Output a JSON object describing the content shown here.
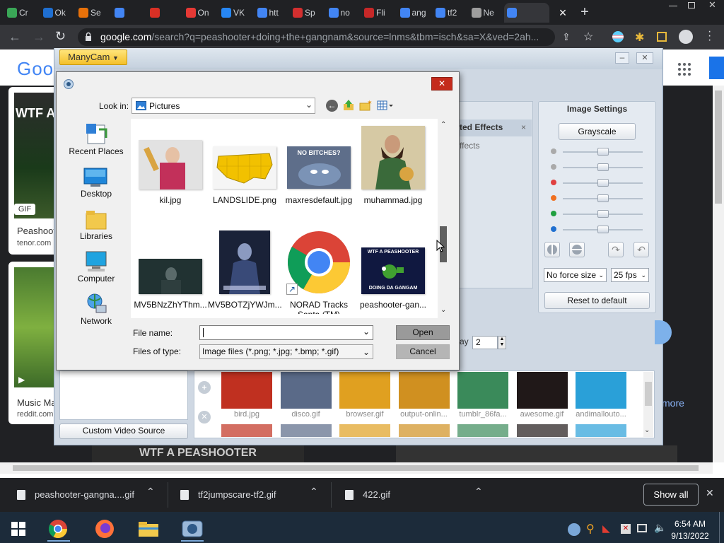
{
  "browser": {
    "tabs": [
      {
        "label": "Cr",
        "color": "#3aa757"
      },
      {
        "label": "Ok",
        "color": "#1f6fd1"
      },
      {
        "label": "Se",
        "color": "#e8710a"
      },
      {
        "label": "",
        "color": "#4285f4"
      },
      {
        "label": "",
        "color": "#d93025"
      },
      {
        "label": "On",
        "color": "#e53935"
      },
      {
        "label": "VK",
        "color": "#2787f5"
      },
      {
        "label": "htt",
        "color": "#4285f4"
      },
      {
        "label": "Sp",
        "color": "#d32f2f"
      },
      {
        "label": "no",
        "color": "#4285f4"
      },
      {
        "label": "Fli",
        "color": "#c62828"
      },
      {
        "label": "ang",
        "color": "#4285f4"
      },
      {
        "label": "tf2",
        "color": "#4285f4"
      },
      {
        "label": "Ne",
        "color": "#9e9e9e"
      },
      {
        "label": "",
        "color": "#4285f4",
        "active": true
      }
    ],
    "url_domain": "google.com",
    "url_rest": "/search?q=peashooter+doing+the+gangnam&source=lnms&tbm=isch&sa=X&ved=2ah...",
    "tab_close": "×",
    "new_tab": "+"
  },
  "google": {
    "logo": "Goo",
    "results": [
      {
        "badge": "GIF",
        "title": "Peashoot",
        "site": "tenor.com",
        "thumb_text": "WTF A"
      },
      {
        "title": "Music Ma",
        "site": "reddit.com"
      }
    ],
    "more_label": "more",
    "bottom_banner": "WTF A PEASHOOTER"
  },
  "manycam": {
    "title_button": "ManyCam",
    "effects_header": "ted Effects",
    "effects_sub": "ffects",
    "image_settings": {
      "header": "Image Settings",
      "grayscale_button": "Grayscale",
      "slider_levels": [
        0.5,
        0.5,
        0.5,
        0.5,
        0.5,
        0.5
      ],
      "force_size": "No force size",
      "fps": "25 fps",
      "reset_button": "Reset to default"
    },
    "delay_label": "ay",
    "delay_value": "2",
    "custom_video_source": "Custom Video Source",
    "gallery": [
      {
        "name": "bird.jpg",
        "c": "#c03020"
      },
      {
        "name": "disco.gif",
        "c": "#5a6a88"
      },
      {
        "name": "browser.gif",
        "c": "#e0a020"
      },
      {
        "name": "output-onlin...",
        "c": "#d09020"
      },
      {
        "name": "tumblr_86fa...",
        "c": "#3a8a5a"
      },
      {
        "name": "awesome.gif",
        "c": "#201818"
      },
      {
        "name": "andimallouto...",
        "c": "#2aa0d8"
      }
    ]
  },
  "dialog": {
    "look_in_label": "Look in:",
    "look_in_value": "Pictures",
    "places": [
      "Recent Places",
      "Desktop",
      "Libraries",
      "Computer",
      "Network"
    ],
    "files": [
      {
        "name": "kil.jpg"
      },
      {
        "name": "LANDSLIDE.png"
      },
      {
        "name": "maxresdefault.jpg",
        "caption": "NO BITCHES?"
      },
      {
        "name": "muhammad.jpg"
      },
      {
        "name": "MV5BNzZhYThm..."
      },
      {
        "name": "MV5BOTZjYWJm..."
      },
      {
        "name": "NORAD Tracks",
        "name2": "Santa (TM)"
      },
      {
        "name": "peashooter-gan...",
        "caption_top": "WTF A PEASHOOTER",
        "caption_bottom": "DOING DA GANGAM"
      }
    ],
    "file_name_label": "File name:",
    "file_name_value": "",
    "files_of_type_label": "Files of type:",
    "files_of_type_value": "Image files (*.png; *.jpg; *.bmp; *.gif)",
    "open_button": "Open",
    "cancel_button": "Cancel",
    "close_glyph": "✕"
  },
  "downloads": {
    "items": [
      "peashooter-gangna....gif",
      "tf2jumpscare-tf2.gif",
      "422.gif"
    ],
    "show_all": "Show all",
    "close_glyph": "✕"
  },
  "taskbar": {
    "time": "6:54 AM",
    "date": "9/13/2022"
  }
}
